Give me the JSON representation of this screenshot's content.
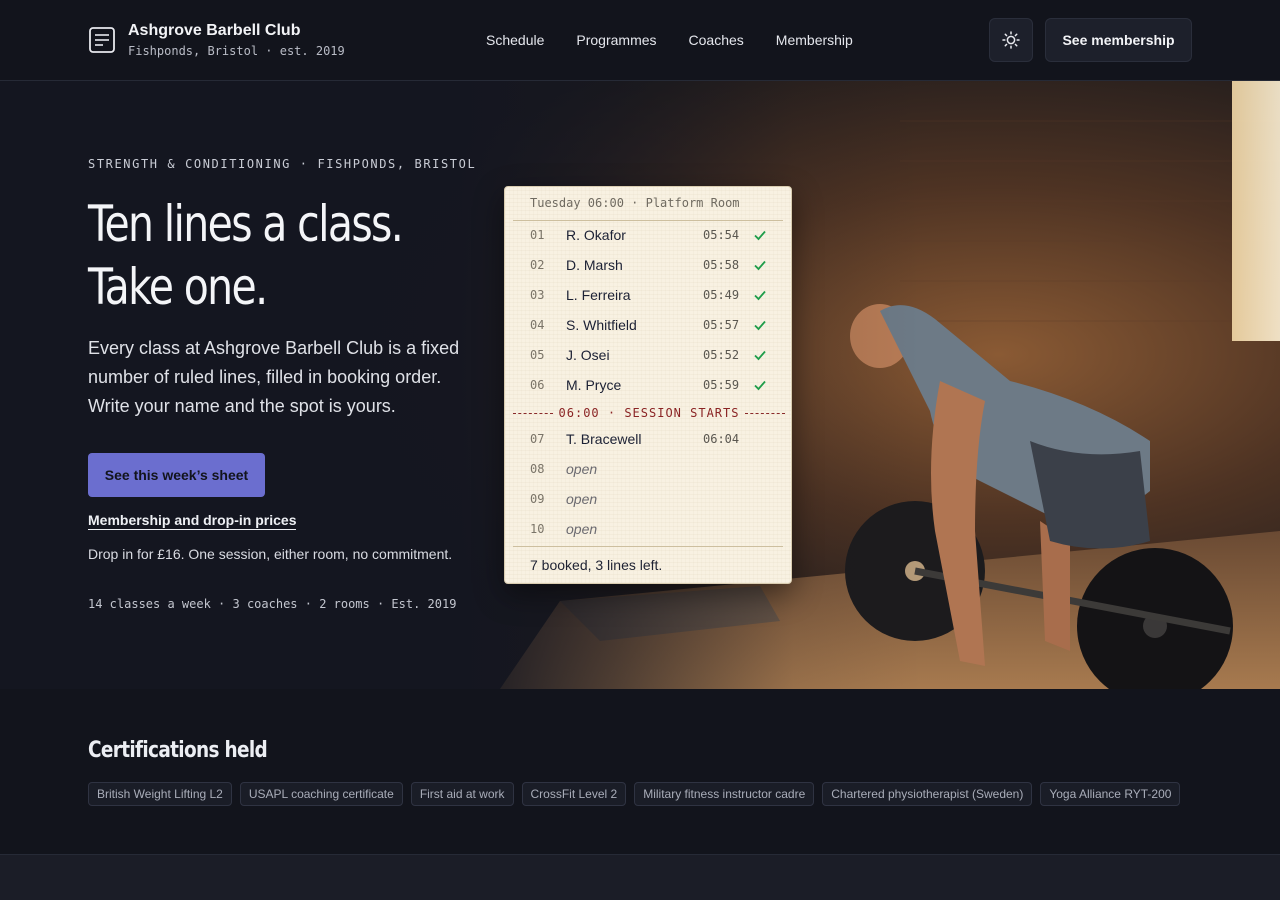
{
  "header": {
    "brand_name": "Ashgrove Barbell Club",
    "brand_sub": "Fishponds, Bristol · est. 2019",
    "nav": [
      "Schedule",
      "Programmes",
      "Coaches",
      "Membership"
    ],
    "cta": "See membership",
    "icons": {
      "logo": "notebook-icon",
      "theme": "sun-icon"
    }
  },
  "hero": {
    "eyebrow": "STRENGTH & CONDITIONING · FISHPONDS, BRISTOL",
    "headline_line1": "Ten lines a class.",
    "headline_line2": "Take one.",
    "lede": "Every class at Ashgrove Barbell Club is a fixed number of ruled lines, filled in booking order. Write your name and the spot is yours.",
    "primary_cta": "See this week’s sheet",
    "secondary_link": "Membership and drop-in prices",
    "dropin": "Drop in for £16. One session, either room, no commitment.",
    "stats": "14 classes a week · 3 coaches · 2 rooms · Est. 2019"
  },
  "sheet": {
    "header": "Tuesday 06:00 · Platform Room",
    "rows": [
      {
        "num": "01",
        "name": "R. Okafor",
        "time": "05:54",
        "checked": true
      },
      {
        "num": "02",
        "name": "D. Marsh",
        "time": "05:58",
        "checked": true
      },
      {
        "num": "03",
        "name": "L. Ferreira",
        "time": "05:49",
        "checked": true
      },
      {
        "num": "04",
        "name": "S. Whitfield",
        "time": "05:57",
        "checked": true
      },
      {
        "num": "05",
        "name": "J. Osei",
        "time": "05:52",
        "checked": true
      },
      {
        "num": "06",
        "name": "M. Pryce",
        "time": "05:59",
        "checked": true
      }
    ],
    "session_label": "06:00 · SESSION STARTS",
    "late_rows": [
      {
        "num": "07",
        "name": "T. Bracewell",
        "time": "06:04",
        "open": false
      },
      {
        "num": "08",
        "name": "open",
        "time": "",
        "open": true
      },
      {
        "num": "09",
        "name": "open",
        "time": "",
        "open": true
      },
      {
        "num": "10",
        "name": "open",
        "time": "",
        "open": true
      }
    ],
    "footer": "7 booked, 3 lines left."
  },
  "certifications": {
    "title": "Certifications held",
    "items": [
      "British Weight Lifting L2",
      "USAPL coaching certificate",
      "First aid at work",
      "CrossFit Level 2",
      "Military fitness instructor cadre",
      "Chartered physiotherapist (Sweden)",
      "Yoga Alliance RYT-200"
    ]
  },
  "colors": {
    "background": "#12141c",
    "accent": "#6b6ecf",
    "sheet_paper": "#f8f1e2",
    "check_green": "#1f9d4a",
    "session_red": "#8a2424"
  }
}
